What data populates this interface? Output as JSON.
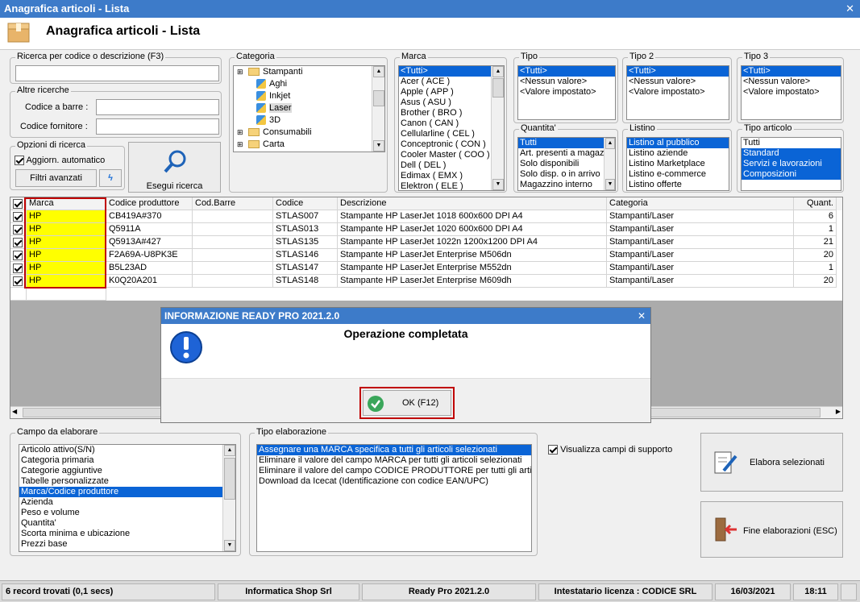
{
  "window": {
    "title": "Anagrafica articoli  - Lista",
    "header": "Anagrafica articoli  - Lista"
  },
  "search": {
    "title": "Ricerca per codice o descrizione (F3)",
    "value": "",
    "other_title": "Altre ricerche",
    "barcode_label": "Codice a barre :",
    "supplier_label": "Codice fornitore :"
  },
  "options": {
    "title": "Opzioni di ricerca",
    "auto_update": "Aggiorn. automatico",
    "advanced": "Filtri avanzati",
    "search_button": "Esegui ricerca"
  },
  "categoria": {
    "title": "Categoria",
    "tree": [
      {
        "label": "Stampanti",
        "level": 0
      },
      {
        "label": "Aghi",
        "level": 1
      },
      {
        "label": "Inkjet",
        "level": 1
      },
      {
        "label": "Laser",
        "level": 1
      },
      {
        "label": "3D",
        "level": 1
      },
      {
        "label": "Consumabili",
        "level": 0
      },
      {
        "label": "Carta",
        "level": 0
      }
    ]
  },
  "marca": {
    "title": "Marca",
    "items": [
      "<Tutti>",
      "Acer ( ACE )",
      "Apple ( APP )",
      "Asus ( ASU )",
      "Brother ( BRO )",
      "Canon ( CAN )",
      "Cellularline ( CEL )",
      "Conceptronic ( CON )",
      "Cooler Master ( COO )",
      "Dell ( DEL )",
      "Edimax ( EMX )",
      "Elektron ( ELE )"
    ]
  },
  "tipo": {
    "title": "Tipo",
    "items": [
      "<Tutti>",
      "<Nessun valore>",
      "<Valore impostato>"
    ]
  },
  "tipo2": {
    "title": "Tipo 2",
    "items": [
      "<Tutti>",
      "<Nessun valore>",
      "<Valore impostato>"
    ]
  },
  "tipo3": {
    "title": "Tipo 3",
    "items": [
      "<Tutti>",
      "<Nessun valore>",
      "<Valore impostato>"
    ]
  },
  "quantita": {
    "title": "Quantita'",
    "items": [
      "Tutti",
      "Art. presenti a magazzino",
      "Solo disponibili",
      "Solo disp. o in arrivo",
      "Magazzino interno"
    ]
  },
  "listino": {
    "title": "Listino",
    "items": [
      "Listino al pubblico",
      "Listino aziende",
      "Listino Marketplace",
      "Listino e-commerce",
      "Listino offerte"
    ]
  },
  "tipo_articolo": {
    "title": "Tipo articolo",
    "items": [
      "Tutti",
      "Standard",
      "Servizi e lavorazioni",
      "Composizioni"
    ]
  },
  "grid": {
    "headers": [
      "Marca",
      "Codice produttore",
      "Cod.Barre",
      "Codice",
      "Descrizione",
      "Categoria",
      "Quant."
    ],
    "rows": [
      {
        "marca": "HP",
        "cod_prod": "CB419A#370",
        "barre": "",
        "codice": "STLAS007",
        "descr": "Stampante HP LaserJet 1018 600x600 DPI A4",
        "cat": "Stampanti/Laser",
        "qty": "6"
      },
      {
        "marca": "HP",
        "cod_prod": "Q5911A",
        "barre": "",
        "codice": "STLAS013",
        "descr": "Stampante HP LaserJet 1020 600x600 DPI A4",
        "cat": "Stampanti/Laser",
        "qty": "1"
      },
      {
        "marca": "HP",
        "cod_prod": "Q5913A#427",
        "barre": "",
        "codice": "STLAS135",
        "descr": "Stampante HP LaserJet 1022n 1200x1200 DPI A4",
        "cat": "Stampanti/Laser",
        "qty": "21"
      },
      {
        "marca": "HP",
        "cod_prod": "F2A69A-U8PK3E",
        "barre": "",
        "codice": "STLAS146",
        "descr": "Stampante HP LaserJet Enterprise M506dn",
        "cat": "Stampanti/Laser",
        "qty": "20"
      },
      {
        "marca": "HP",
        "cod_prod": "B5L23AD",
        "barre": "",
        "codice": "STLAS147",
        "descr": "Stampante HP LaserJet Enterprise M552dn",
        "cat": "Stampanti/Laser",
        "qty": "1"
      },
      {
        "marca": "HP",
        "cod_prod": "K0Q20A201",
        "barre": "",
        "codice": "STLAS148",
        "descr": "Stampante HP LaserJet Enterprise M609dh",
        "cat": "Stampanti/Laser",
        "qty": "20"
      }
    ]
  },
  "campo": {
    "title": "Campo da elaborare",
    "items": [
      "Articolo attivo(S/N)",
      "Categoria primaria",
      "Categorie aggiuntive",
      "Tabelle personalizzate",
      "Marca/Codice produttore",
      "Azienda",
      "Peso e volume",
      "Quantita'",
      "Scorta minima e ubicazione",
      "Prezzi base"
    ]
  },
  "tipo_elab": {
    "title": "Tipo elaborazione",
    "items": [
      "Assegnare una MARCA specifica a tutti gli articoli selezionati",
      "Eliminare il valore del campo MARCA per tutti gli articoli selezionati",
      "Eliminare il valore del campo CODICE PRODUTTORE per tutti gli articoli",
      "Download da Icecat (Identificazione con codice EAN/UPC)"
    ]
  },
  "support_fields": "Visualizza campi di supporto",
  "actions": {
    "elabora": "Elabora selezionati",
    "fine": "Fine elaborazioni (ESC)"
  },
  "dialog": {
    "title": "INFORMAZIONE READY PRO 2021.2.0",
    "message": "Operazione completata",
    "ok": "OK (F12)"
  },
  "status": {
    "records": "6 record trovati (0,1 secs)",
    "company": "Informatica Shop Srl",
    "product": "Ready Pro 2021.2.0",
    "license": "Intestatario licenza : CODICE SRL",
    "date": "16/03/2021",
    "time": "18:11"
  },
  "colors": {
    "title_blue": "#3d7bc9",
    "selection": "#0a64d6",
    "highlight": "#ffff00",
    "red_box": "#c00000"
  }
}
